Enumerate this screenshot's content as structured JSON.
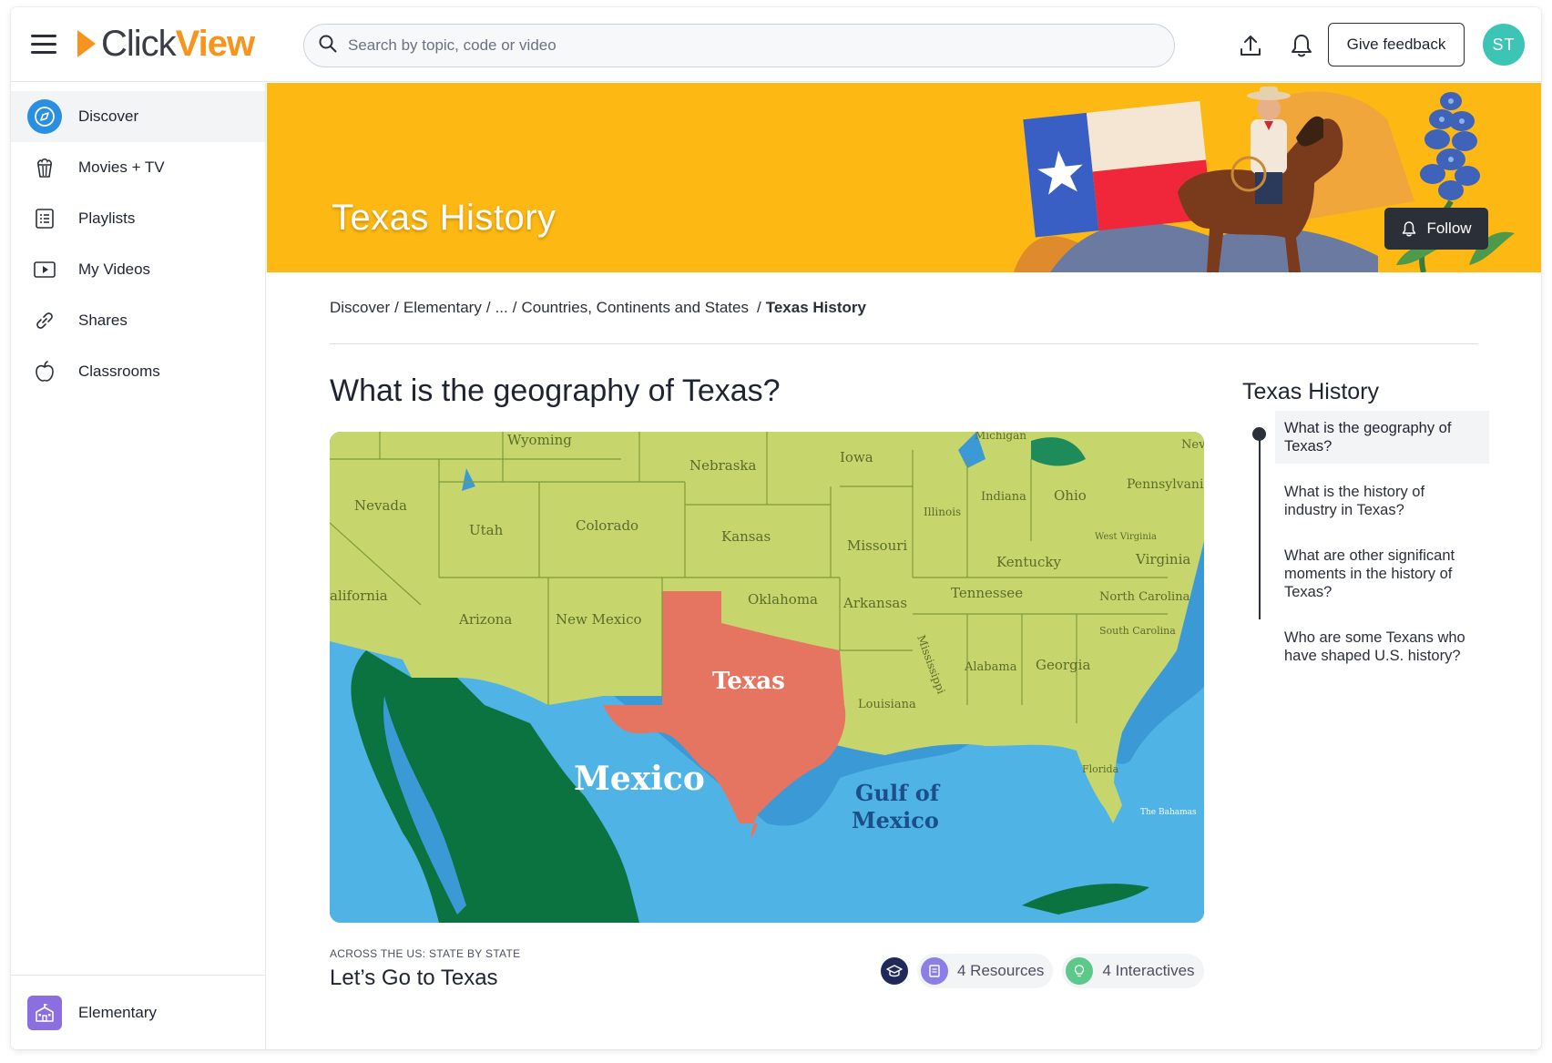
{
  "header": {
    "logo_part1": "Click",
    "logo_part2": "View",
    "search_placeholder": "Search by topic, code or video",
    "feedback_label": "Give feedback",
    "avatar_initials": "ST"
  },
  "sidebar": {
    "items": [
      {
        "label": "Discover",
        "icon": "compass-icon",
        "active": true
      },
      {
        "label": "Movies + TV",
        "icon": "popcorn-icon"
      },
      {
        "label": "Playlists",
        "icon": "list-icon"
      },
      {
        "label": "My Videos",
        "icon": "video-play-icon"
      },
      {
        "label": "Shares",
        "icon": "link-icon"
      },
      {
        "label": "Classrooms",
        "icon": "apple-icon"
      }
    ],
    "footer_label": "Elementary"
  },
  "banner": {
    "title": "Texas History",
    "follow_label": "Follow"
  },
  "breadcrumb": {
    "items": [
      "Discover",
      "Elementary",
      "...",
      "Countries, Continents and States"
    ],
    "current": "Texas History"
  },
  "main": {
    "question": "What is the geography of Texas?",
    "series_label": "ACROSS THE US: STATE BY STATE",
    "video_title": "Let’s Go to Texas",
    "resources_label": "4 Resources",
    "interactives_label": "4 Interactives"
  },
  "map": {
    "labels": {
      "wyoming": "Wyoming",
      "michigan": "Michigan",
      "nebraska": "Nebraska",
      "iowa": "Iowa",
      "nevada": "Nevada",
      "utah": "Utah",
      "colorado": "Colorado",
      "kansas": "Kansas",
      "illinois": "Illinois",
      "indiana": "Indiana",
      "ohio": "Ohio",
      "pennsylvania": "Pennsylvani",
      "missouri": "Missouri",
      "west_virginia": "West Virginia",
      "virginia": "Virginia",
      "kentucky": "Kentucky",
      "california": "alifornia",
      "oklahoma": "Oklahoma",
      "tennessee": "Tennessee",
      "north_carolina": "North Carolina",
      "arizona": "Arizona",
      "new_mexico": "New Mexico",
      "arkansas": "Arkansas",
      "south_carolina": "South Carolina",
      "mississippi": "Mississippi",
      "alabama": "Alabama",
      "georgia": "Georgia",
      "texas": "Texas",
      "louisiana": "Louisiana",
      "mexico": "Mexico",
      "gulf1": "Gulf of",
      "gulf2": "Mexico",
      "florida": "Florida",
      "bahamas": "The Bahamas",
      "new": "Nev"
    }
  },
  "toc": {
    "title": "Texas History",
    "items": [
      "What is the geography of Texas?",
      "What is the history of industry in Texas?",
      "What are other significant moments in the history of Texas?",
      "Who are some Texans who have shaped U.S. history?"
    ]
  },
  "colors": {
    "brand_orange": "#f7941d",
    "banner_yellow": "#fdb813",
    "avatar_teal": "#3cc4b4",
    "discover_blue": "#2a8fe0",
    "texas_red": "#e57560",
    "mexico_green": "#0a7340",
    "land_green": "#c7d66c",
    "water_blue": "#3b9ad6"
  }
}
